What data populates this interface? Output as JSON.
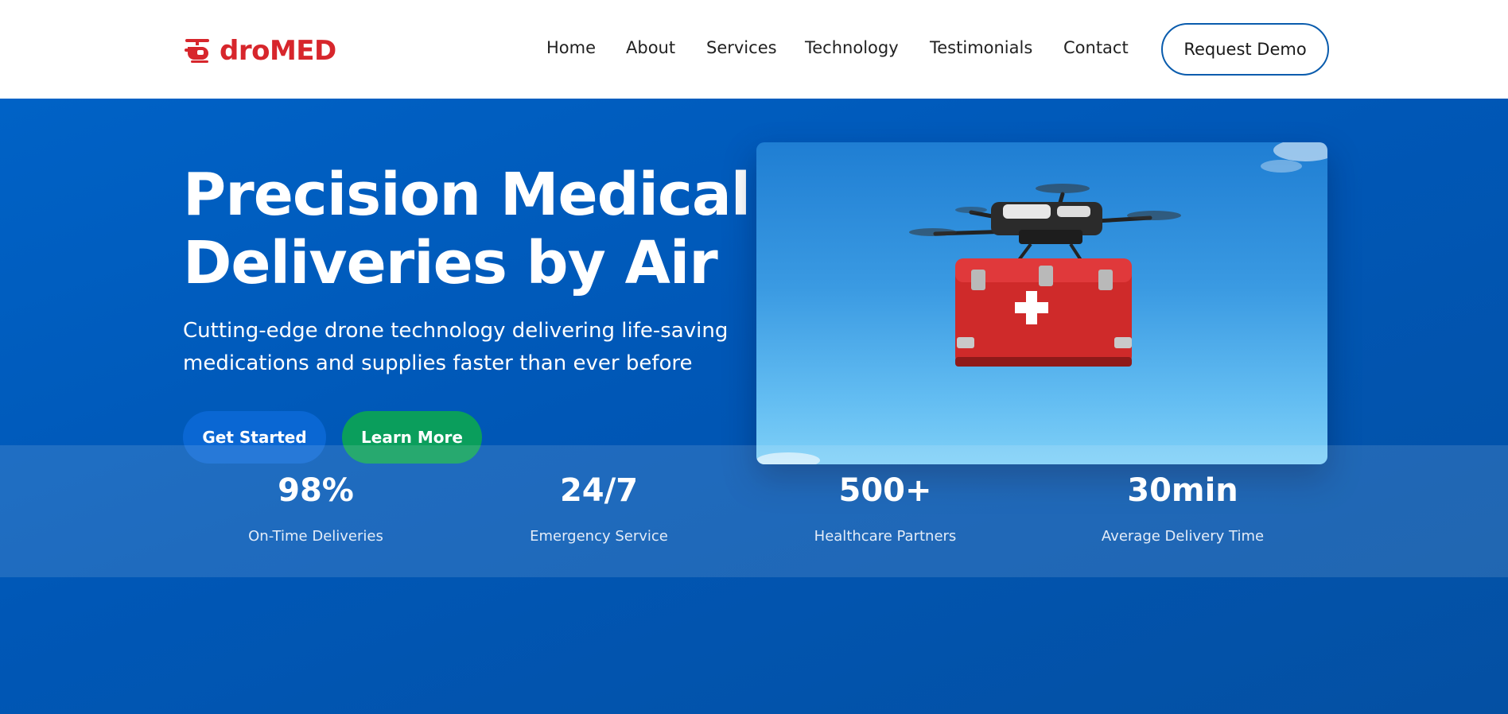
{
  "header": {
    "logo_text": "droMED",
    "nav": [
      "Home",
      "About",
      "Services",
      "Technology",
      "Testimonials",
      "Contact"
    ],
    "cta_label": "Request Demo"
  },
  "hero": {
    "title_line1": "Precision Medical",
    "title_line2": "Deliveries by Air",
    "subtitle_line1": "Cutting-edge drone technology delivering life-saving",
    "subtitle_line2": "medications and supplies faster than ever before",
    "primary_button": "Get Started",
    "secondary_button": "Learn More"
  },
  "stats": [
    {
      "value": "98%",
      "label": "On-Time Deliveries"
    },
    {
      "value": "24/7",
      "label": "Emergency Service"
    },
    {
      "value": "500+",
      "label": "Healthcare Partners"
    },
    {
      "value": "30min",
      "label": "Average Delivery Time"
    }
  ],
  "colors": {
    "brand_red": "#d7262c",
    "hero_blue": "#0057b8",
    "accent_green": "#0a9e5c",
    "button_blue": "#0a67d3"
  },
  "icons": {
    "logo": "helicopter-icon"
  }
}
